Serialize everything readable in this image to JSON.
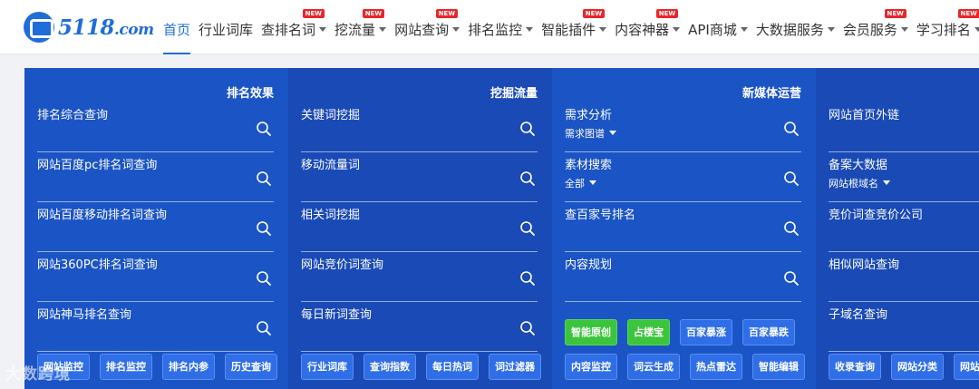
{
  "header": {
    "logo_text": "5118",
    "logo_domain": ".com",
    "nav": [
      {
        "label": "首页",
        "active": true,
        "caret": false,
        "new": false
      },
      {
        "label": "行业词库",
        "active": false,
        "caret": false,
        "new": false
      },
      {
        "label": "查排名词",
        "active": false,
        "caret": true,
        "new": true
      },
      {
        "label": "挖流量",
        "active": false,
        "caret": true,
        "new": true
      },
      {
        "label": "网站查询",
        "active": false,
        "caret": true,
        "new": true
      },
      {
        "label": "排名监控",
        "active": false,
        "caret": true,
        "new": false
      },
      {
        "label": "智能插件",
        "active": false,
        "caret": true,
        "new": true
      },
      {
        "label": "内容神器",
        "active": false,
        "caret": true,
        "new": true
      },
      {
        "label": "API商城",
        "active": false,
        "caret": true,
        "new": false
      },
      {
        "label": "大数据服务",
        "active": false,
        "caret": true,
        "new": false
      },
      {
        "label": "会员服务",
        "active": false,
        "caret": true,
        "new": true
      },
      {
        "label": "学习排名",
        "active": false,
        "caret": true,
        "new": true
      }
    ],
    "new_badge": "NEW"
  },
  "panels": [
    {
      "title": "排名效果",
      "rows": [
        {
          "label": "排名综合查询",
          "sub": ""
        },
        {
          "label": "网站百度pc排名词查询",
          "sub": ""
        },
        {
          "label": "网站百度移动排名词查询",
          "sub": ""
        },
        {
          "label": "网站360PC排名词查询",
          "sub": ""
        },
        {
          "label": "网站神马排名查询",
          "sub": ""
        }
      ],
      "buttons_top": [],
      "buttons": [
        "网站监控",
        "排名监控",
        "排名内参",
        "历史查询"
      ]
    },
    {
      "title": "挖掘流量",
      "rows": [
        {
          "label": "关键词挖掘",
          "sub": ""
        },
        {
          "label": "移动流量词",
          "sub": ""
        },
        {
          "label": "相关词挖掘",
          "sub": ""
        },
        {
          "label": "网站竞价词查询",
          "sub": ""
        },
        {
          "label": "每日新词查询",
          "sub": ""
        }
      ],
      "buttons_top": [],
      "buttons": [
        "行业词库",
        "查询指数",
        "每日热词",
        "词过滤器"
      ]
    },
    {
      "title": "新媒体运营",
      "rows": [
        {
          "label": "需求分析",
          "sub": "需求图谱"
        },
        {
          "label": "素材搜索",
          "sub": "全部"
        },
        {
          "label": "查百家号排名",
          "sub": ""
        },
        {
          "label": "内容规划",
          "sub": ""
        }
      ],
      "buttons_top": [
        "智能原创",
        "占楼宝",
        "百家暴涨",
        "百家暴跌"
      ],
      "buttons": [
        "内容监控",
        "词云生成",
        "热点雷达",
        "智能编辑"
      ]
    },
    {
      "title": "",
      "rows": [
        {
          "label": "网站首页外链",
          "sub": ""
        },
        {
          "label": "备案大数据",
          "sub": "网站根域名"
        },
        {
          "label": "竞价词查竞价公司",
          "sub": ""
        },
        {
          "label": "相似网站查询",
          "sub": ""
        },
        {
          "label": "子域名查询",
          "sub": ""
        }
      ],
      "buttons_top": [],
      "buttons": [
        "收录查询",
        "网站分类",
        "网站"
      ]
    }
  ],
  "watermark": "大数跨境",
  "colors": {
    "brand": "#1f6dd8",
    "panel_dark": "#1a4ab6",
    "panel_light": "#1b54c4",
    "new_badge": "#e8262a",
    "green_button": "#3cc53c"
  }
}
